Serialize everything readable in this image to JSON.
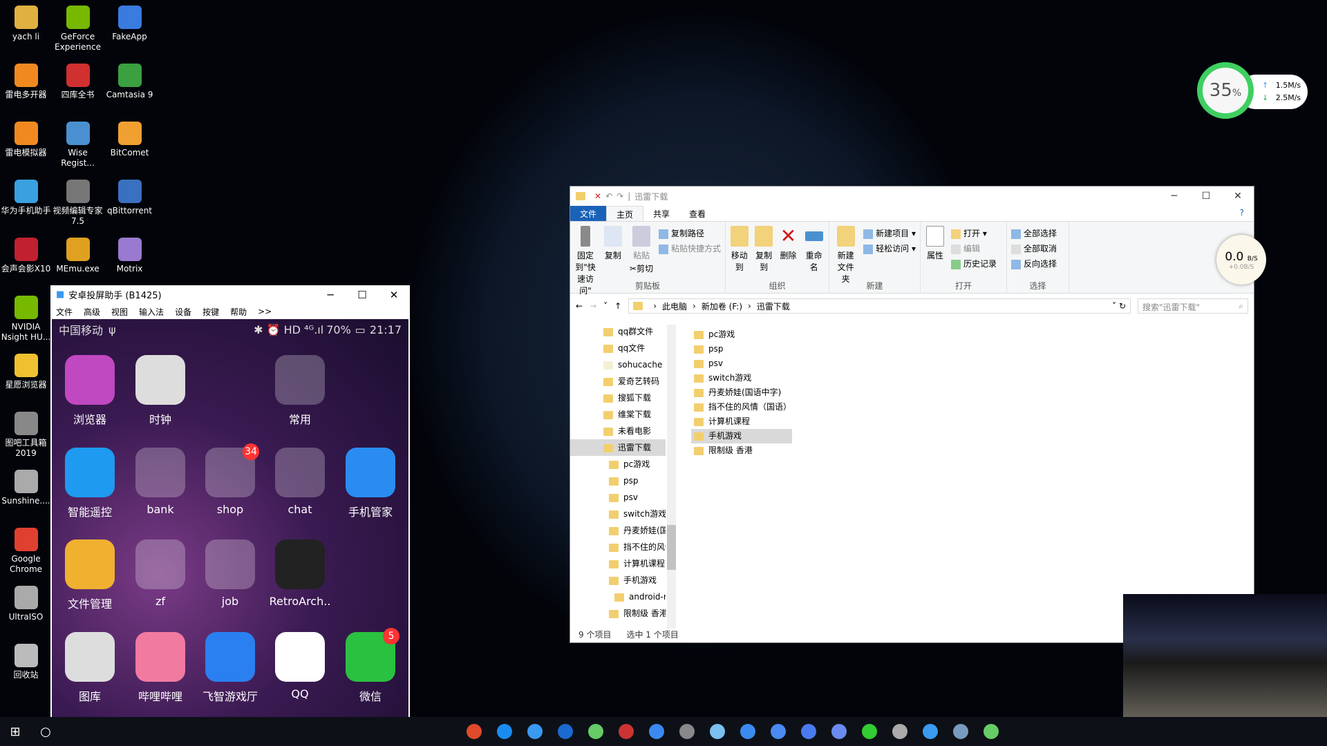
{
  "desktop": {
    "icons": [
      {
        "label": "yach li",
        "color": "#e0b040"
      },
      {
        "label": "GeForce Experience",
        "color": "#76b900"
      },
      {
        "label": "FakeApp",
        "color": "#3a7be0"
      },
      {
        "label": "雷电多开器",
        "color": "#f08a20"
      },
      {
        "label": "四库全书",
        "color": "#d03030"
      },
      {
        "label": "Camtasia 9",
        "color": "#3aa040"
      },
      {
        "label": "雷电模拟器",
        "color": "#f08a20"
      },
      {
        "label": "Wise Regist...",
        "color": "#4a90d0"
      },
      {
        "label": "BitComet",
        "color": "#f0a030"
      },
      {
        "label": "华为手机助手",
        "color": "#3aa0e0"
      },
      {
        "label": "视频编辑专家 7.5",
        "color": "#777"
      },
      {
        "label": "qBittorrent",
        "color": "#3a70c0"
      },
      {
        "label": "会声会影X10",
        "color": "#c02030"
      },
      {
        "label": "MEmu.exe",
        "color": "#e0a020"
      },
      {
        "label": "Motrix",
        "color": "#9a7ad0"
      },
      {
        "label": "NVIDIA Nsight HU...",
        "color": "#76b900"
      },
      {
        "label": "星愿浏览器",
        "color": "#f0c030"
      },
      {
        "label": "图吧工具箱 2019",
        "color": "#888"
      },
      {
        "label": "Sunshine....",
        "color": "#aaa"
      },
      {
        "label": "Google Chrome",
        "color": "#e04030"
      },
      {
        "label": "UltraISO",
        "color": "#aaa"
      },
      {
        "label": "回收站",
        "color": "#bbb"
      }
    ]
  },
  "android": {
    "title": "安卓投屏助手 (B1425)",
    "menu": [
      "文件",
      "高级",
      "视图",
      "输入法",
      "设备",
      "按键",
      "帮助",
      ">>"
    ],
    "status": {
      "carrier": "中国移动",
      "battery": "70%",
      "time": "21:17"
    },
    "apps": [
      {
        "label": "浏览器",
        "color": "#c048c0"
      },
      {
        "label": "时钟",
        "color": "#ddd"
      },
      {
        "label": "",
        "color": ""
      },
      {
        "label": "常用",
        "color": "rgba(255,255,255,.25)"
      },
      {
        "label": "",
        "color": ""
      },
      {
        "label": "智能遥控",
        "color": "#1e9af0"
      },
      {
        "label": "bank",
        "color": "rgba(255,255,255,.25)"
      },
      {
        "label": "shop",
        "color": "rgba(255,255,255,.25)",
        "badge": "34"
      },
      {
        "label": "chat",
        "color": "rgba(255,255,255,.25)"
      },
      {
        "label": "手机管家",
        "color": "#2a8cf0"
      },
      {
        "label": "文件管理",
        "color": "#f0b030"
      },
      {
        "label": "zf",
        "color": "rgba(255,255,255,.25)"
      },
      {
        "label": "job",
        "color": "rgba(255,255,255,.25)"
      },
      {
        "label": "RetroArch..",
        "color": "#222"
      },
      {
        "label": "",
        "color": ""
      },
      {
        "label": "图库",
        "color": "#ddd"
      },
      {
        "label": "哔哩哔哩",
        "color": "#f07aa0"
      },
      {
        "label": "飞智游戏厅",
        "color": "#2a80f0"
      },
      {
        "label": "QQ",
        "color": "#fff"
      },
      {
        "label": "微信",
        "color": "#2ac040",
        "badge": "5"
      }
    ]
  },
  "explorer": {
    "title": "迅雷下载",
    "tabs": [
      "文件",
      "主页",
      "共享",
      "查看"
    ],
    "ribbon": {
      "clipboard": {
        "label": "剪贴板",
        "pin": "固定到\"快速访问\"",
        "copy": "复制",
        "paste": "粘贴",
        "copy_path": "复制路径",
        "paste_shortcut": "粘贴快捷方式",
        "cut": "剪切"
      },
      "organize": {
        "label": "组织",
        "move": "移动到",
        "copyto": "复制到",
        "delete": "删除",
        "rename": "重命名"
      },
      "new": {
        "label": "新建",
        "folder": "新建\n文件夹",
        "item": "新建项目",
        "easy": "轻松访问"
      },
      "open": {
        "label": "打开",
        "props": "属性",
        "open": "打开",
        "edit": "编辑",
        "history": "历史记录"
      },
      "select": {
        "label": "选择",
        "all": "全部选择",
        "none": "全部取消",
        "invert": "反向选择"
      }
    },
    "path": [
      "此电脑",
      "新加卷 (F:)",
      "迅雷下载"
    ],
    "search_placeholder": "搜索\"迅雷下载\"",
    "tree": [
      {
        "n": "qq群文件",
        "l": 0
      },
      {
        "n": "qq文件",
        "l": 0
      },
      {
        "n": "sohucache",
        "l": 0
      },
      {
        "n": "爱奇艺转码",
        "l": 0
      },
      {
        "n": "搜狐下载",
        "l": 0
      },
      {
        "n": "维棠下载",
        "l": 0
      },
      {
        "n": "未看电影",
        "l": 0
      },
      {
        "n": "迅雷下载",
        "l": 0,
        "sel": true
      },
      {
        "n": "pc游戏",
        "l": 1
      },
      {
        "n": "psp",
        "l": 1
      },
      {
        "n": "psv",
        "l": 1
      },
      {
        "n": "switch游戏",
        "l": 1
      },
      {
        "n": "丹麦娇娃(国",
        "l": 1
      },
      {
        "n": "挡不住的风情",
        "l": 1
      },
      {
        "n": "计算机课程",
        "l": 1
      },
      {
        "n": "手机游戏",
        "l": 1
      },
      {
        "n": "android-r",
        "l": 2
      },
      {
        "n": "限制级 香港",
        "l": 1
      }
    ],
    "files": [
      {
        "n": "pc游戏"
      },
      {
        "n": "psp"
      },
      {
        "n": "psv"
      },
      {
        "n": "switch游戏"
      },
      {
        "n": "丹麦娇娃(国语中字)"
      },
      {
        "n": "挡不住的风情（国语）"
      },
      {
        "n": "计算机课程"
      },
      {
        "n": "手机游戏",
        "sel": true
      },
      {
        "n": "限制级 香港"
      }
    ],
    "status": {
      "count": "9 个项目",
      "selected": "选中 1 个项目"
    }
  },
  "netball": {
    "speed": "0.0",
    "unit": "B/S",
    "sub": "+0.0B/S"
  },
  "speed_widget": {
    "percent": "35",
    "up": "1.5M/s",
    "down": "2.5M/s",
    "ring_color": "#3fcf61"
  },
  "taskbar": {
    "icons": [
      "start-icon",
      "search-icon",
      "chrome-icon",
      "edge-icon",
      "app-icon",
      "app-icon",
      "app-icon",
      "app-icon",
      "app-icon",
      "app-icon",
      "app-icon",
      "app-icon",
      "app-icon",
      "app-icon",
      "app-icon",
      "wechat-icon",
      "app-icon",
      "android-icon",
      "app-icon",
      "app-icon"
    ]
  }
}
